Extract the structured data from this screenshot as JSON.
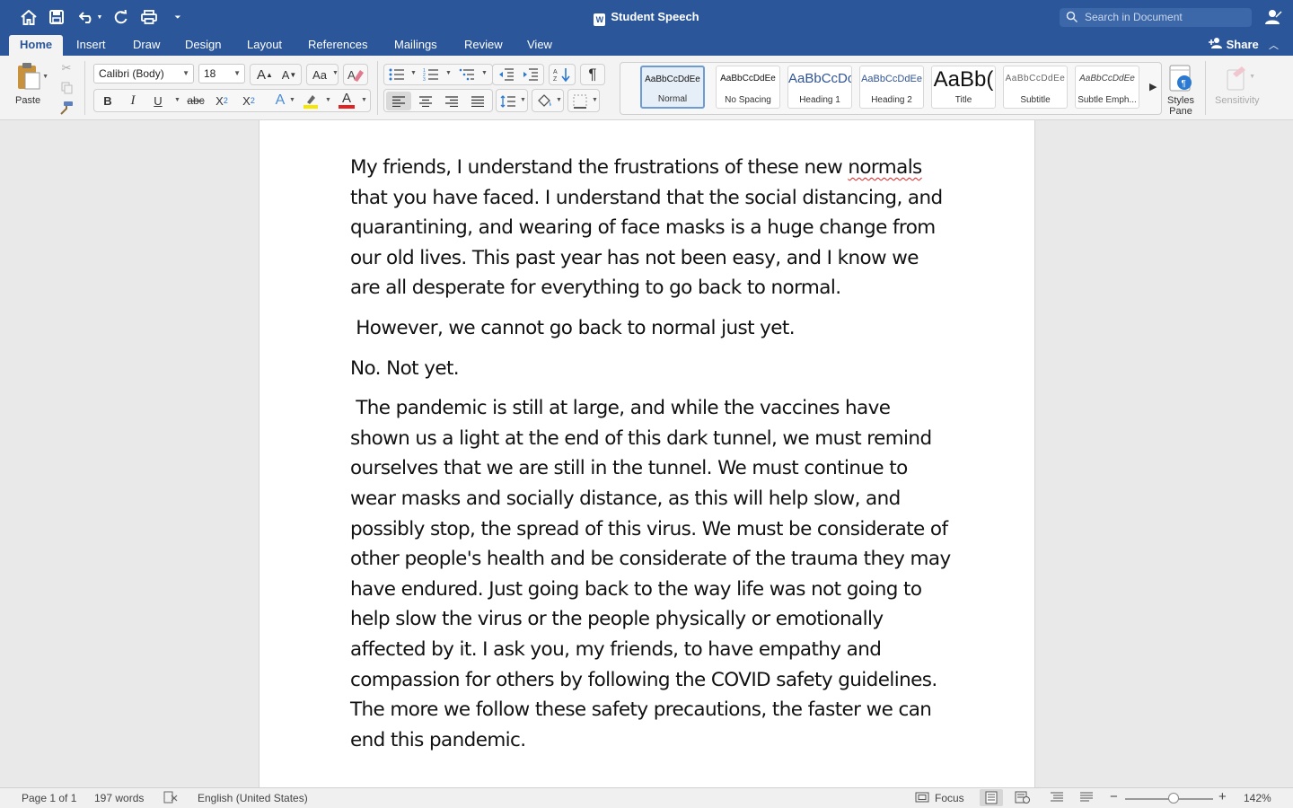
{
  "app": {
    "title": "Student Speech",
    "search_placeholder": "Search in Document",
    "brand_color": "#2b579a"
  },
  "tabs": [
    {
      "label": "Home",
      "active": true
    },
    {
      "label": "Insert"
    },
    {
      "label": "Draw"
    },
    {
      "label": "Design"
    },
    {
      "label": "Layout"
    },
    {
      "label": "References"
    },
    {
      "label": "Mailings"
    },
    {
      "label": "Review"
    },
    {
      "label": "View"
    }
  ],
  "share_label": "Share",
  "ribbon": {
    "paste_label": "Paste",
    "font_name": "Calibri (Body)",
    "font_size": "18",
    "bold": "B",
    "italic": "I",
    "underline": "U",
    "strike": "abc",
    "subscript_base": "X",
    "subscript_mark": "2",
    "superscript_base": "X",
    "superscript_mark": "2",
    "grow_font": "A",
    "shrink_font": "A",
    "change_case": "Aa",
    "text_effects": "A",
    "font_color_letter": "A",
    "pilcrow": "¶",
    "highlight_color": "#f7e600",
    "font_color": "#e32222",
    "styles": [
      {
        "preview": "AaBbCcDdEe",
        "name": "Normal",
        "selected": true
      },
      {
        "preview": "AaBbCcDdEe",
        "name": "No Spacing"
      },
      {
        "preview": "AaBbCcDc",
        "name": "Heading 1"
      },
      {
        "preview": "AaBbCcDdEe",
        "name": "Heading 2"
      },
      {
        "preview": "AaBb(",
        "name": "Title"
      },
      {
        "preview": "AaBbCcDdEe",
        "name": "Subtitle"
      },
      {
        "preview": "AaBbCcDdEe",
        "name": "Subtle Emph..."
      }
    ],
    "styles_pane_label1": "Styles",
    "styles_pane_label2": "Pane",
    "sensitivity_label": "Sensitivity"
  },
  "document": {
    "p1_before": "My friends, I understand the frustrations of these new ",
    "p1_misspelled": "normals",
    "p1_after": " that you have faced. I understand that the social distancing, and quarantining, and wearing of face masks is a huge change from our old lives. This past year has not been easy, and I know we are all desperate for everything to go back to normal.",
    "p2": " However, we cannot go back to normal just yet.",
    "p3": "No. Not yet.",
    "p4": " The pandemic is still at large, and while the vaccines have shown us a light at the end of this dark tunnel, we must remind ourselves that we are still in the tunnel. We must continue to wear masks and socially distance, as this will help slow, and possibly stop, the spread of this virus. We must be considerate of other people's health and be considerate of the trauma they may have endured. Just going back to the way life was not going to help slow the virus or the people physically or emotionally affected by it. I ask you, my friends, to have empathy and compassion for others by following the COVID safety guidelines. The more we follow these safety precautions, the faster we can end this pandemic."
  },
  "status": {
    "page": "Page 1 of 1",
    "words": "197 words",
    "language": "English (United States)",
    "focus": "Focus",
    "zoom": "142%",
    "zoom_fraction": 0.55
  }
}
